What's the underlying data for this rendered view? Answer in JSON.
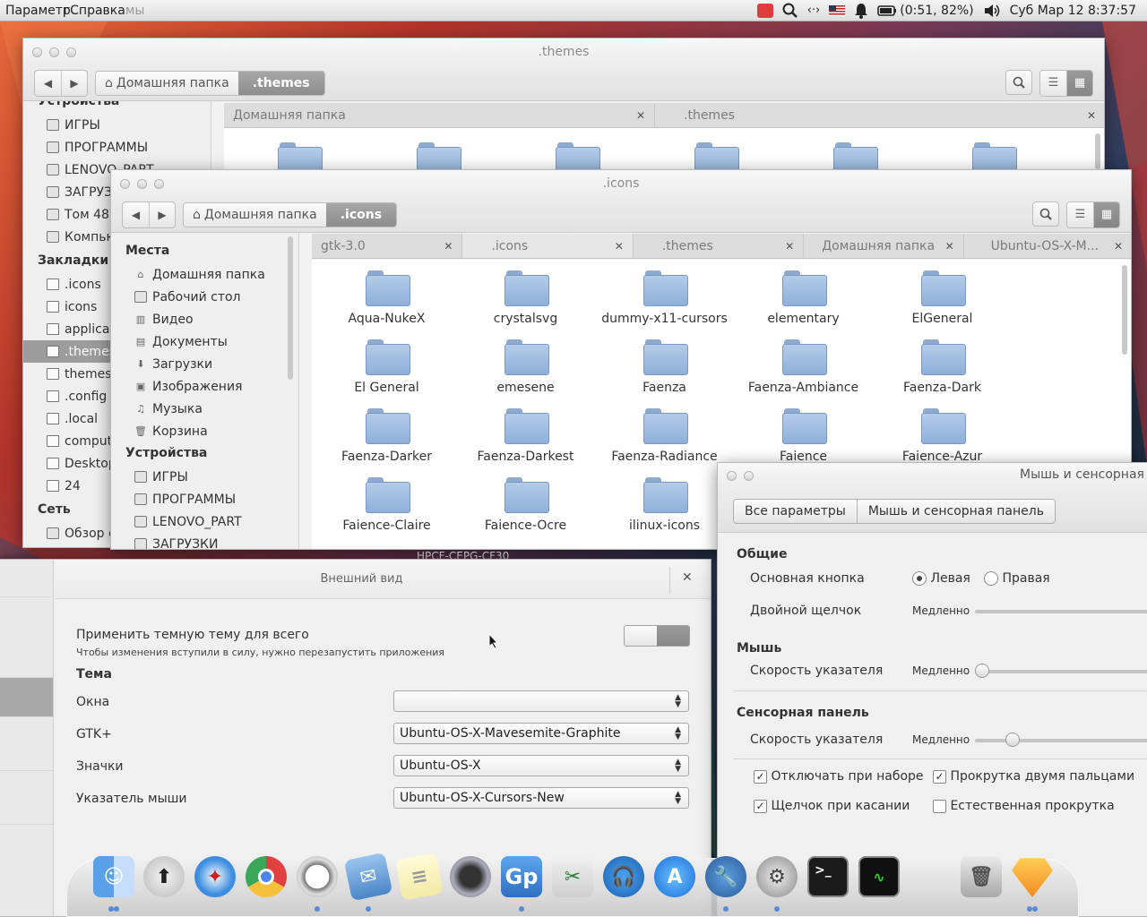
{
  "top_panel": {
    "app_menu_1": "Параметр",
    "app_menu_overlap": "гСправка",
    "app_menu_ghost": "мы",
    "battery": "(0:51, 82%)",
    "datetime": "Суб Мар 12  8:37:57"
  },
  "back_window": {
    "title": ".themes",
    "crumb_home": "Домашняя папка",
    "crumb_current": ".themes",
    "tabs": [
      {
        "label": "Домашняя папка"
      },
      {
        "label": ".themes"
      }
    ],
    "sidebar_partial_header": "Устройства",
    "sidebar_devices": [
      "ИГРЫ",
      "ПРОГРАММЫ",
      "LENOVO_PART",
      "ЗАГРУЗ",
      "Том 48 (",
      "Компью"
    ],
    "bookmarks_header": "Закладки",
    "bookmarks": [
      ".icons",
      "icons",
      "applicat",
      ".themes",
      "themes",
      ".config",
      ".local",
      "comput",
      "Desktop",
      "24"
    ],
    "network_header": "Сеть",
    "network_items": [
      "Обзор с"
    ]
  },
  "icons_window": {
    "title": ".icons",
    "crumb_home": "Домашняя папка",
    "crumb_current": ".icons",
    "tabs": [
      {
        "label": "gtk-3.0"
      },
      {
        "label": ".icons"
      },
      {
        "label": ".themes"
      },
      {
        "label": "Домашняя папка"
      },
      {
        "label": "Ubuntu-OS-X-M..."
      }
    ],
    "places_header": "Места",
    "places": [
      "Домашняя папка",
      "Рабочий стол",
      "Видео",
      "Документы",
      "Загрузки",
      "Изображения",
      "Музыка",
      "Корзина"
    ],
    "devices_header": "Устройства",
    "devices": [
      "ИГРЫ",
      "ПРОГРАММЫ",
      "LENOVO_PART",
      "ЗАГРУЗКИ"
    ],
    "folders": [
      "Aqua-NukeX",
      "crystalsvg",
      "dummy-x11-cursors",
      "elementary",
      "ElGeneral",
      "El General",
      "emesene",
      "Faenza",
      "Faenza-Ambiance",
      "Faenza-Dark",
      "Faenza-Darker",
      "Faenza-Darkest",
      "Faenza-Radiance",
      "Faience",
      "Faience-Azur",
      "Faience-Claire",
      "Faience-Ocre",
      "ilinux-icons"
    ],
    "behind_text": "HPCF-CEPG-CF30"
  },
  "appearance_window": {
    "title": "Внешний вид",
    "dark_theme_label": "Применить темную тему для всего",
    "dark_theme_note": "Чтобы изменения вступили в силу, нужно перезапустить приложения",
    "theme_header": "Тема",
    "windows_label": "Окна",
    "windows_value": "",
    "gtk_label": "GTK+",
    "gtk_value": "Ubuntu-OS-X-Mavesemite-Graphite",
    "icons_label": "Значки",
    "icons_value": "Ubuntu-OS-X",
    "cursor_label": "Указатель мыши",
    "cursor_value": "Ubuntu-OS-X-Cursors-New",
    "dark_theme_enabled": false
  },
  "mouse_window": {
    "title": "Мышь и сенсорная п",
    "all_settings": "Все параметры",
    "current": "Мышь и сенсорная панель",
    "general_header": "Общие",
    "primary_button_label": "Основная кнопка",
    "left": "Левая",
    "right": "Правая",
    "double_click_label": "Двойной щелчок",
    "slow": "Медленно",
    "mouse_header": "Мышь",
    "pointer_speed_label": "Скорость указателя",
    "touchpad_header": "Сенсорная панель",
    "touch_speed_label": "Скорость указателя",
    "disable_typing": "Отключать при наборе",
    "two_finger": "Прокрутка двумя пальцами",
    "tap_click": "Щелчок при касании",
    "natural_scroll": "Естественная прокрутка",
    "disable_typing_checked": true,
    "two_finger_checked": true,
    "tap_click_checked": true,
    "natural_scroll_checked": false
  },
  "dock": {
    "items": [
      "finder-icon",
      "update-icon",
      "safari-icon",
      "chrome-icon",
      "opera-icon",
      "mail-icon",
      "notes-icon",
      "facetime-icon",
      "gp-icon",
      "scissors-icon",
      "headphones-icon",
      "appstore-icon",
      "wrench-icon",
      "settings-icon",
      "terminal-icon",
      "monitor-icon",
      "trash-icon",
      "sketch-icon"
    ],
    "gp_label": "Gp"
  },
  "colors": {
    "selection": "#9c9c9c",
    "folder": "#9fbde3",
    "accent_blue": "#5a8ad0"
  }
}
